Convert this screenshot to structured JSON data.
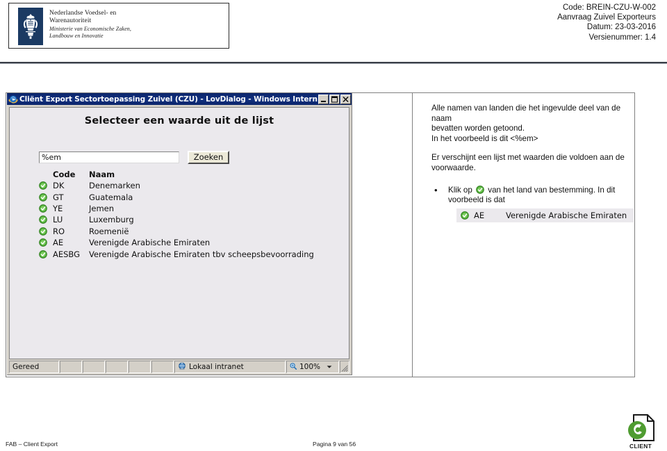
{
  "header": {
    "organization": {
      "line1": "Nederlandse Voedsel- en",
      "line2": "Warenautoriteit",
      "line3": "Ministerie van Economische Zaken,",
      "line4": "Landbouw en Innovatie",
      "crest_icon": "dutch-royal-crest-icon",
      "crest_color": "#1b3a63"
    },
    "meta": {
      "code": "Code: BREIN-CZU-W-002",
      "subject": "Aanvraag Zuivel Exporteurs",
      "date": "Datum: 23-03-2016",
      "version": "Versienummer: 1.4"
    }
  },
  "ie_window": {
    "title": "Cliënt Export Sectortoepassing Zuivel (CZU) - LovDialog - Windows Internet Explorer",
    "app_icon": "internet-explorer-icon",
    "titlebar_color": "#0a246a",
    "controls": {
      "minimize": "minimize-icon",
      "maximize": "maximize-icon",
      "close": "close-icon"
    },
    "heading": "Selecteer een waarde uit de lijst",
    "search": {
      "value": "%em",
      "placeholder": "",
      "button_label": "Zoeken"
    },
    "list": {
      "columns": [
        "Code",
        "Naam"
      ],
      "pick_icon": "green-check-circle-icon",
      "rows": [
        {
          "code": "DK",
          "naam": "Denemarken"
        },
        {
          "code": "GT",
          "naam": "Guatemala"
        },
        {
          "code": "YE",
          "naam": "Jemen"
        },
        {
          "code": "LU",
          "naam": "Luxemburg"
        },
        {
          "code": "RO",
          "naam": "Roemenië"
        },
        {
          "code": "AE",
          "naam": "Verenigde Arabische Emiraten"
        },
        {
          "code": "AESBG",
          "naam": "Verenigde Arabische Emiraten tbv scheepsbevoorrading"
        }
      ]
    },
    "statusbar": {
      "status": "Gereed",
      "zone": "Lokaal intranet",
      "zone_icon": "intranet-globe-icon",
      "zoom_level": "100%",
      "zoom_icon": "magnifier-icon",
      "zoom_dropdown_icon": "chevron-down-icon",
      "resize_grip_icon": "resize-grip-icon"
    }
  },
  "notes": {
    "paragraph1_line1": "Alle namen van landen die het ingevulde deel van de naam",
    "paragraph1_line2": "bevatten worden getoond.",
    "paragraph1_line3": "In het voorbeeld is dit <%em>",
    "paragraph2_line1": "Er verschijnt een lijst met waarden die voldoen aan de",
    "paragraph2_line2": "voorwaarde.",
    "bullet_marker": "•",
    "bullet_text_before": "Klik op",
    "bullet_icon": "green-check-circle-icon",
    "bullet_text_after": "van het land van bestemming. In dit",
    "bullet_text_line2": "voorbeeld is dat",
    "example_row": {
      "pick_icon": "green-check-circle-icon",
      "code": "AE",
      "naam": "Verenigde Arabische Emiraten"
    }
  },
  "footer": {
    "left": "FAB – Client Export",
    "page": "Pagina 9 van 56",
    "logo": {
      "icon": "client-document-logo-icon",
      "label": "CLIENT",
      "accent_color": "#4f9c31"
    }
  }
}
